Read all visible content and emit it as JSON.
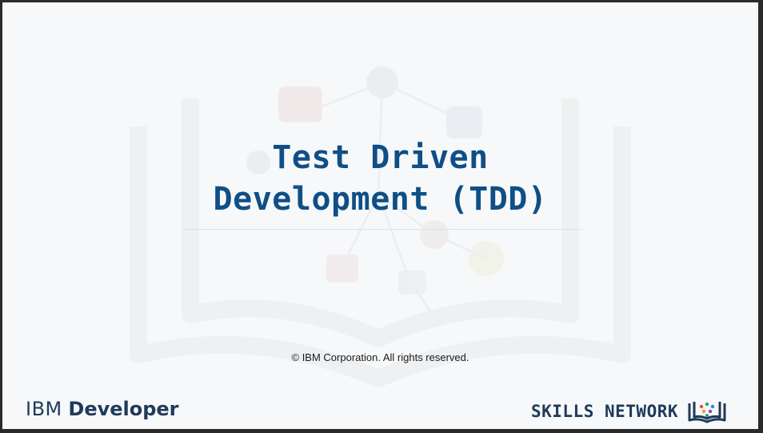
{
  "slide": {
    "title_line1": "Test Driven",
    "title_line2": "Development (TDD)",
    "copyright": "© IBM Corporation. All rights reserved.",
    "ibm_brand_part1": "IBM",
    "ibm_brand_part2": "Developer",
    "skills_brand": "SKILLS NETWORK"
  },
  "colors": {
    "title": "#0f4f87",
    "brand_dark": "#1f3a5a",
    "background": "#f7f8f9"
  },
  "icons": [
    "book-watermark-icon",
    "skills-network-book-icon"
  ]
}
